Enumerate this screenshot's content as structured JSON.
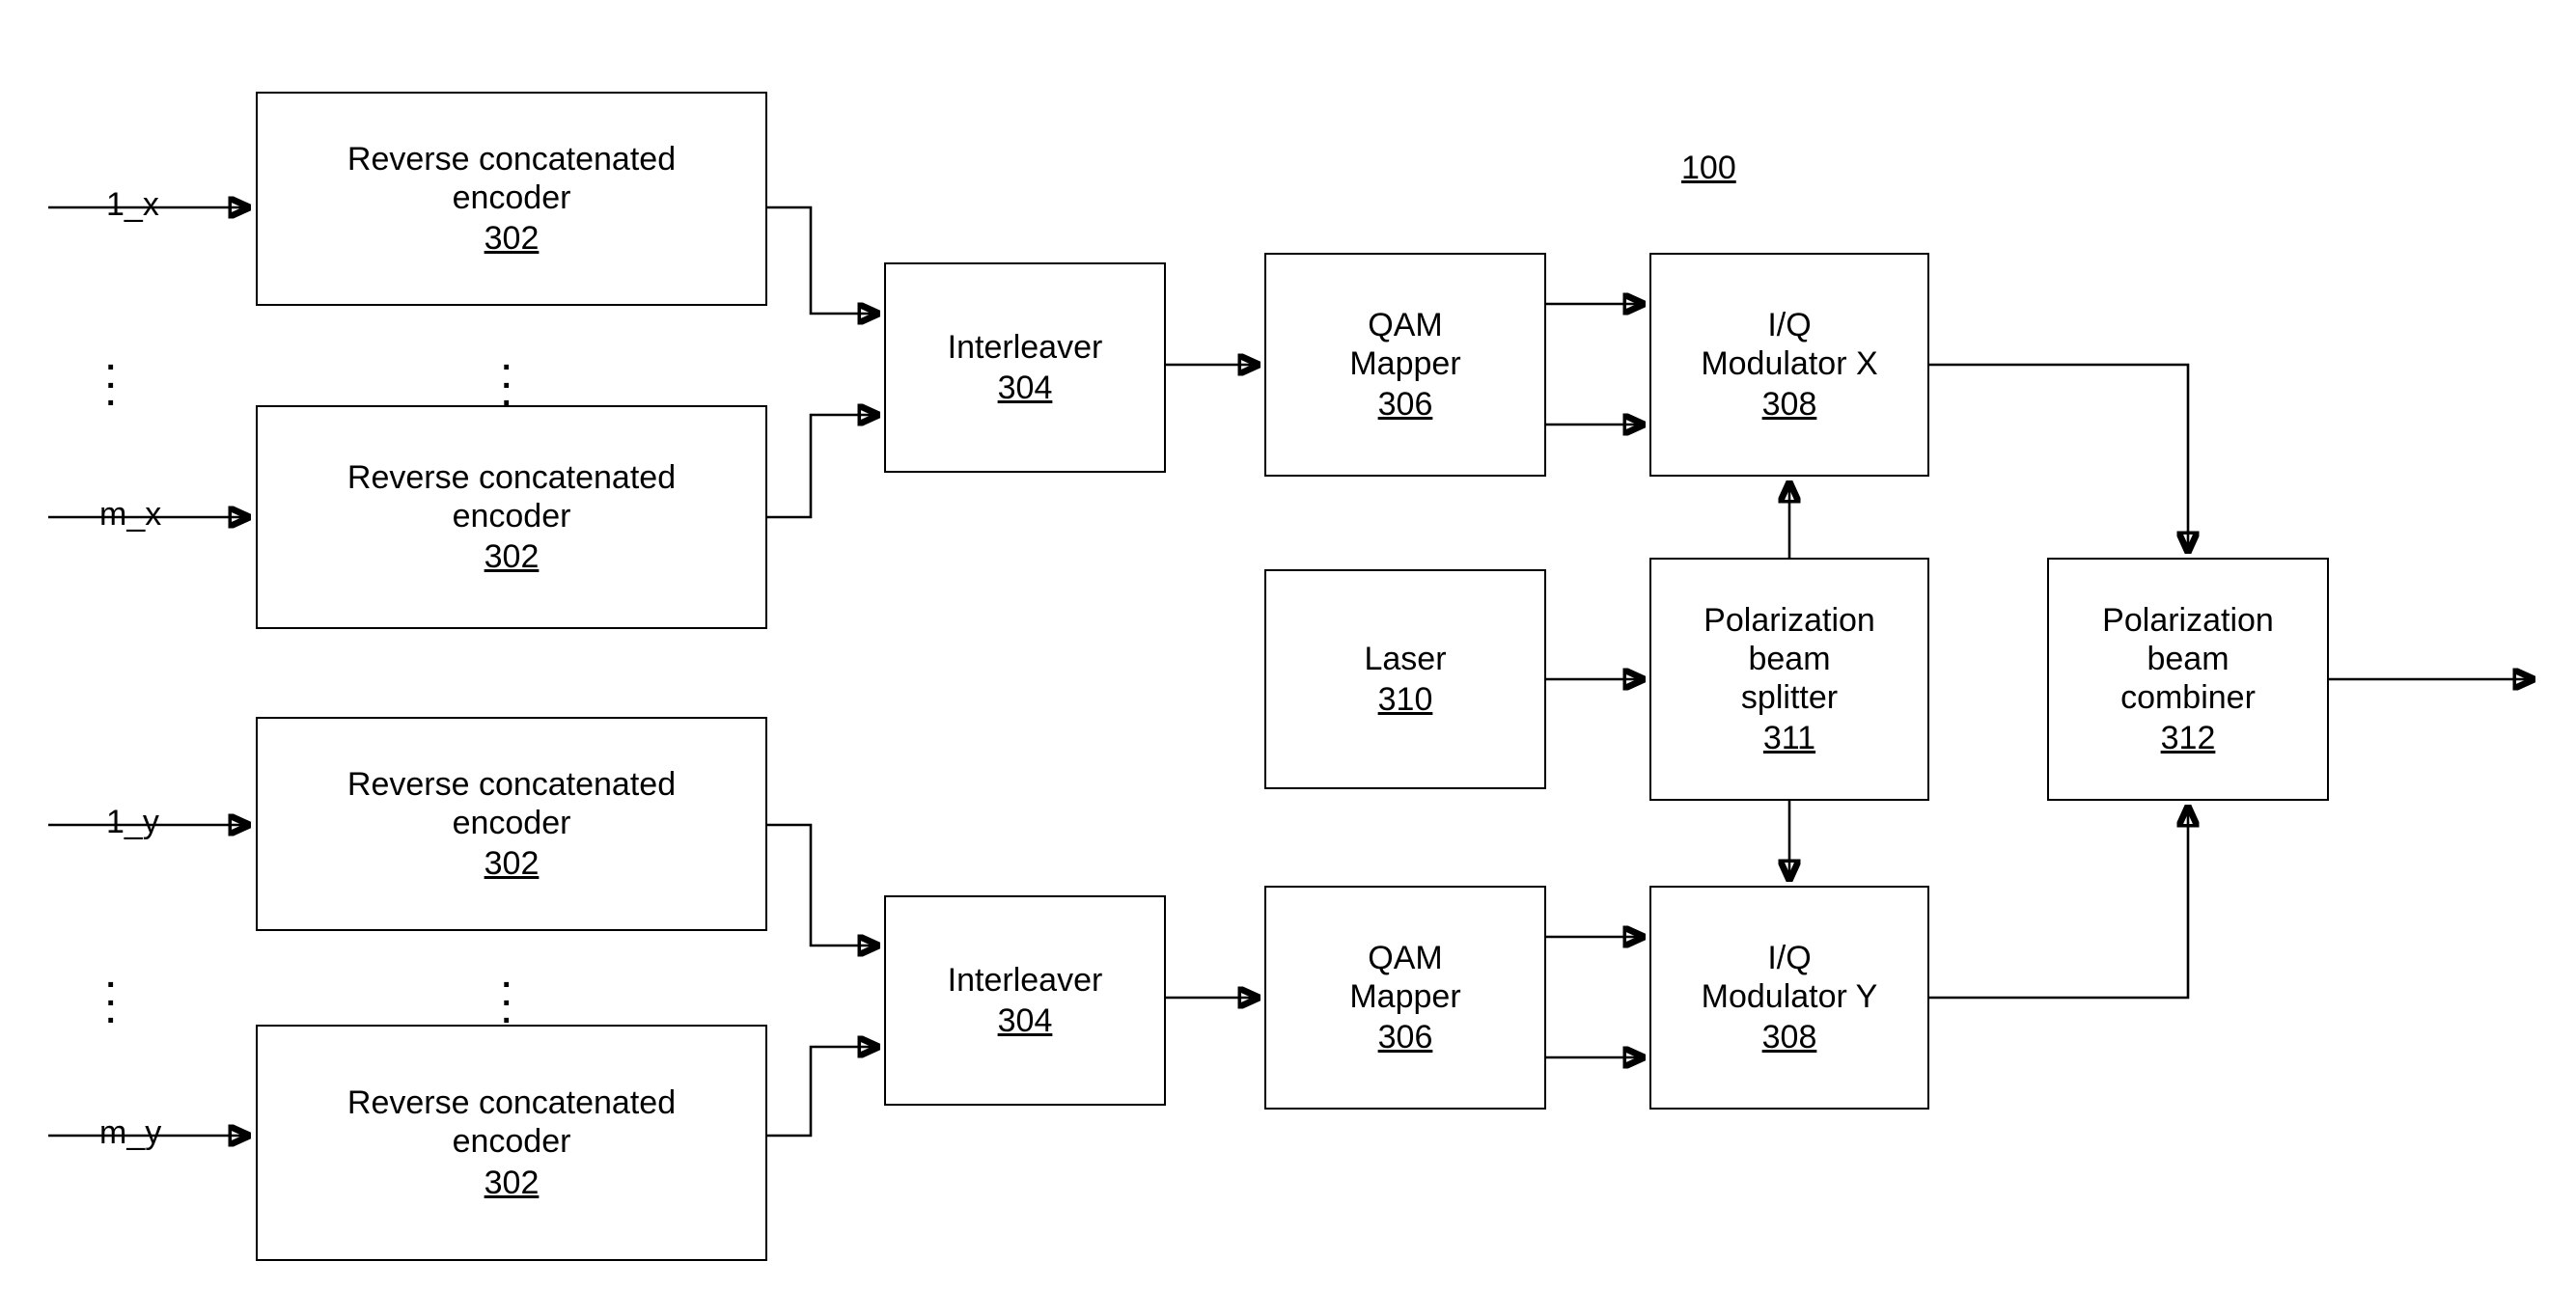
{
  "figure": {
    "number": "100",
    "domain": "optical-transmitter-block-diagram"
  },
  "inputs": [
    {
      "id": "in-1x",
      "label": "1_x"
    },
    {
      "id": "in-mx",
      "label": "m_x"
    },
    {
      "id": "in-1y",
      "label": "1_y"
    },
    {
      "id": "in-my",
      "label": "m_y"
    }
  ],
  "blocks": {
    "encoder_1x": {
      "line1": "Reverse concatenated",
      "line2": "encoder",
      "ref": "302"
    },
    "encoder_mx": {
      "line1": "Reverse concatenated",
      "line2": "encoder",
      "ref": "302"
    },
    "encoder_1y": {
      "line1": "Reverse concatenated",
      "line2": "encoder",
      "ref": "302"
    },
    "encoder_my": {
      "line1": "Reverse concatenated",
      "line2": "encoder",
      "ref": "302"
    },
    "interleaver_x": {
      "line1": "Interleaver",
      "ref": "304"
    },
    "interleaver_y": {
      "line1": "Interleaver",
      "ref": "304"
    },
    "qam_mapper_x": {
      "line1": "QAM",
      "line2": "Mapper",
      "ref": "306"
    },
    "qam_mapper_y": {
      "line1": "QAM",
      "line2": "Mapper",
      "ref": "306"
    },
    "iq_modulator_x": {
      "line1": "I/Q",
      "line2": "Modulator X",
      "ref": "308"
    },
    "iq_modulator_y": {
      "line1": "I/Q",
      "line2": "Modulator Y",
      "ref": "308"
    },
    "laser": {
      "line1": "Laser",
      "ref": "310"
    },
    "pol_beam_splitter": {
      "line1": "Polarization",
      "line2": "beam",
      "line3": "splitter",
      "ref": "311"
    },
    "pol_beam_combiner": {
      "line1": "Polarization",
      "line2": "beam",
      "line3": "combiner",
      "ref": "312"
    }
  },
  "ellipses": [
    {
      "id": "ellipsis-input-x"
    },
    {
      "id": "ellipsis-encoder-x"
    },
    {
      "id": "ellipsis-input-y"
    },
    {
      "id": "ellipsis-encoder-y"
    }
  ]
}
